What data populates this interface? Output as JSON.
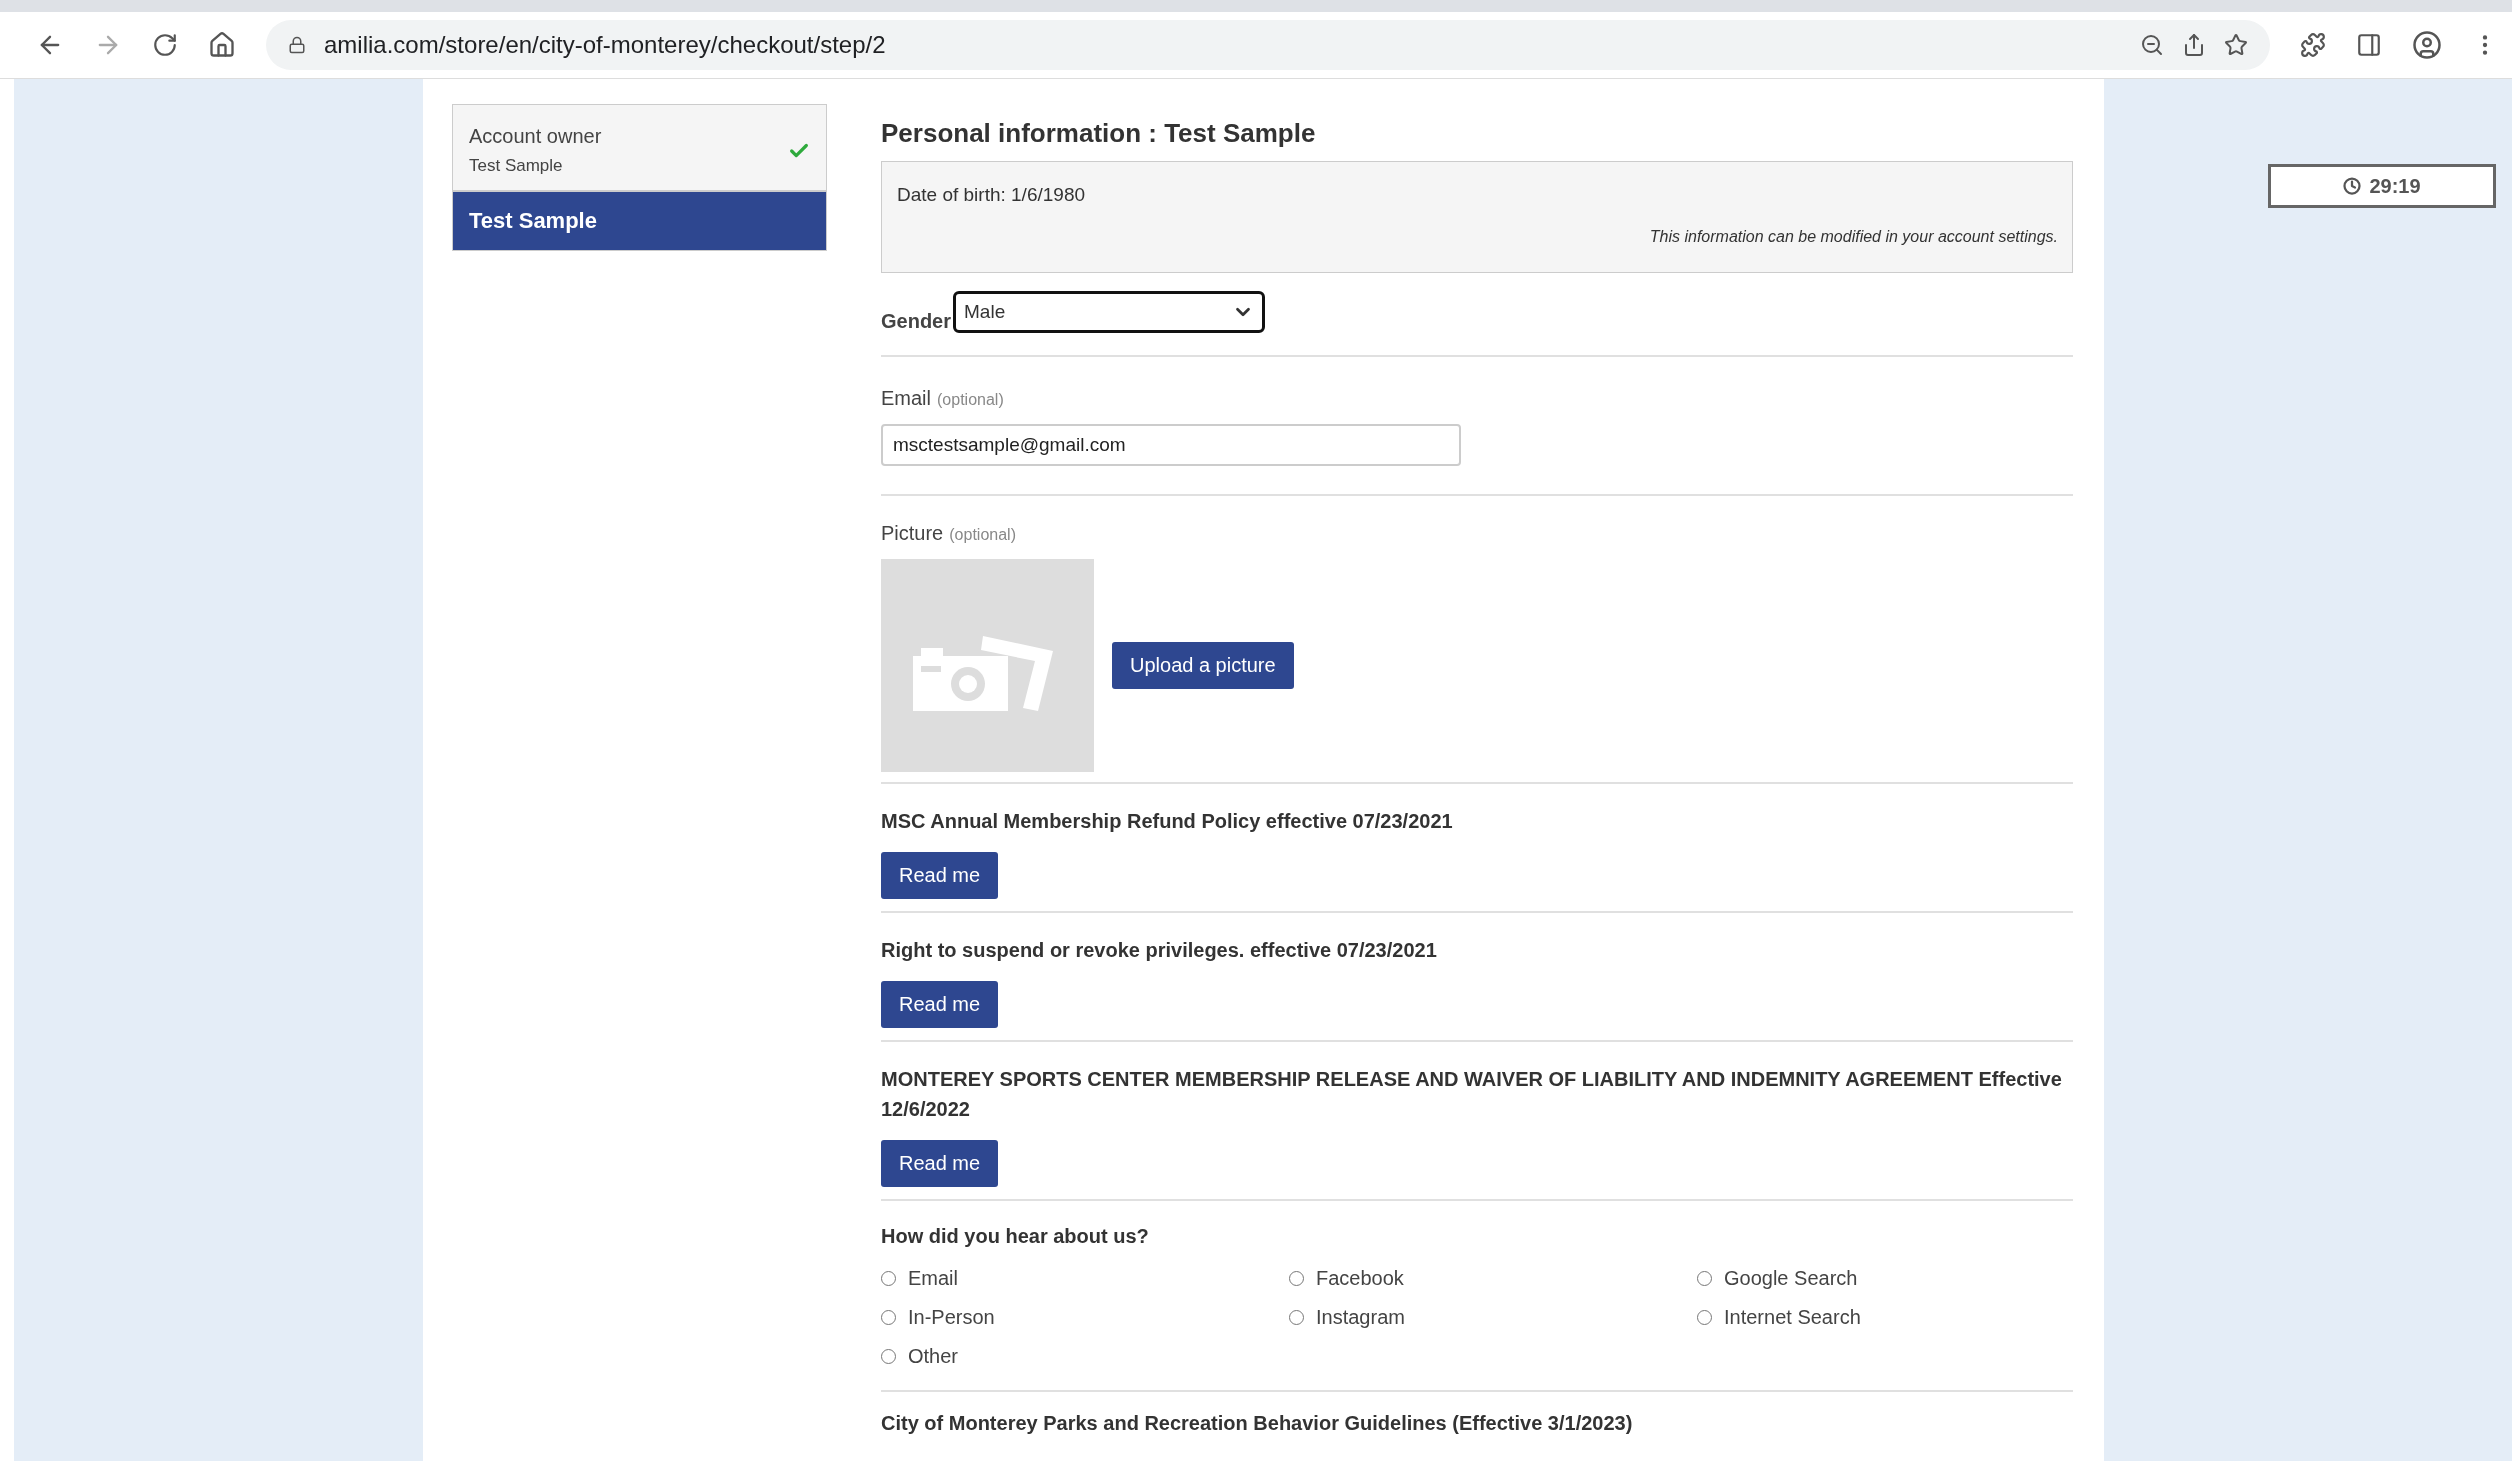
{
  "browser": {
    "url": "amilia.com/store/en/city-of-monterey/checkout/step/2"
  },
  "sidebar": {
    "items": [
      {
        "title": "Account owner",
        "subtitle": "Test Sample",
        "completed": true,
        "selected": false
      },
      {
        "title": "Test Sample",
        "completed": false,
        "selected": true
      }
    ]
  },
  "form": {
    "title": "Personal information : Test Sample",
    "info_box": {
      "birth_date": "Date of birth: 1/6/1980",
      "note": "This information can be modified in your account settings."
    },
    "gender": {
      "label": "Gender",
      "value": "Male"
    },
    "email": {
      "label": "Email",
      "hint": "(optional)",
      "value": "msctestsample@gmail.com"
    },
    "picture": {
      "label": "Picture",
      "hint": "(optional)",
      "button": "Upload a picture"
    },
    "policies": [
      {
        "title": "MSC Annual Membership Refund Policy effective 07/23/2021",
        "button": "Read me"
      },
      {
        "title": "Right to suspend or revoke privileges. effective 07/23/2021",
        "button": "Read me"
      },
      {
        "title": "MONTEREY SPORTS CENTER MEMBERSHIP RELEASE AND WAIVER OF LIABILITY AND INDEMNITY AGREEMENT Effective 12/6/2022",
        "button": "Read me"
      }
    ],
    "survey": {
      "question": "How did you hear about us?",
      "options": [
        {
          "label": "Email",
          "selected": false
        },
        {
          "label": "Facebook",
          "selected": false
        },
        {
          "label": "Google Search",
          "selected": false
        },
        {
          "label": "In-Person",
          "selected": false
        },
        {
          "label": "Instagram",
          "selected": false
        },
        {
          "label": "Internet Search",
          "selected": false
        },
        {
          "label": "Other",
          "selected": false
        }
      ]
    },
    "last_heading": "City of Monterey Parks and Recreation Behavior Guidelines (Effective 3/1/2023)"
  },
  "timer": {
    "value": "29:19"
  }
}
